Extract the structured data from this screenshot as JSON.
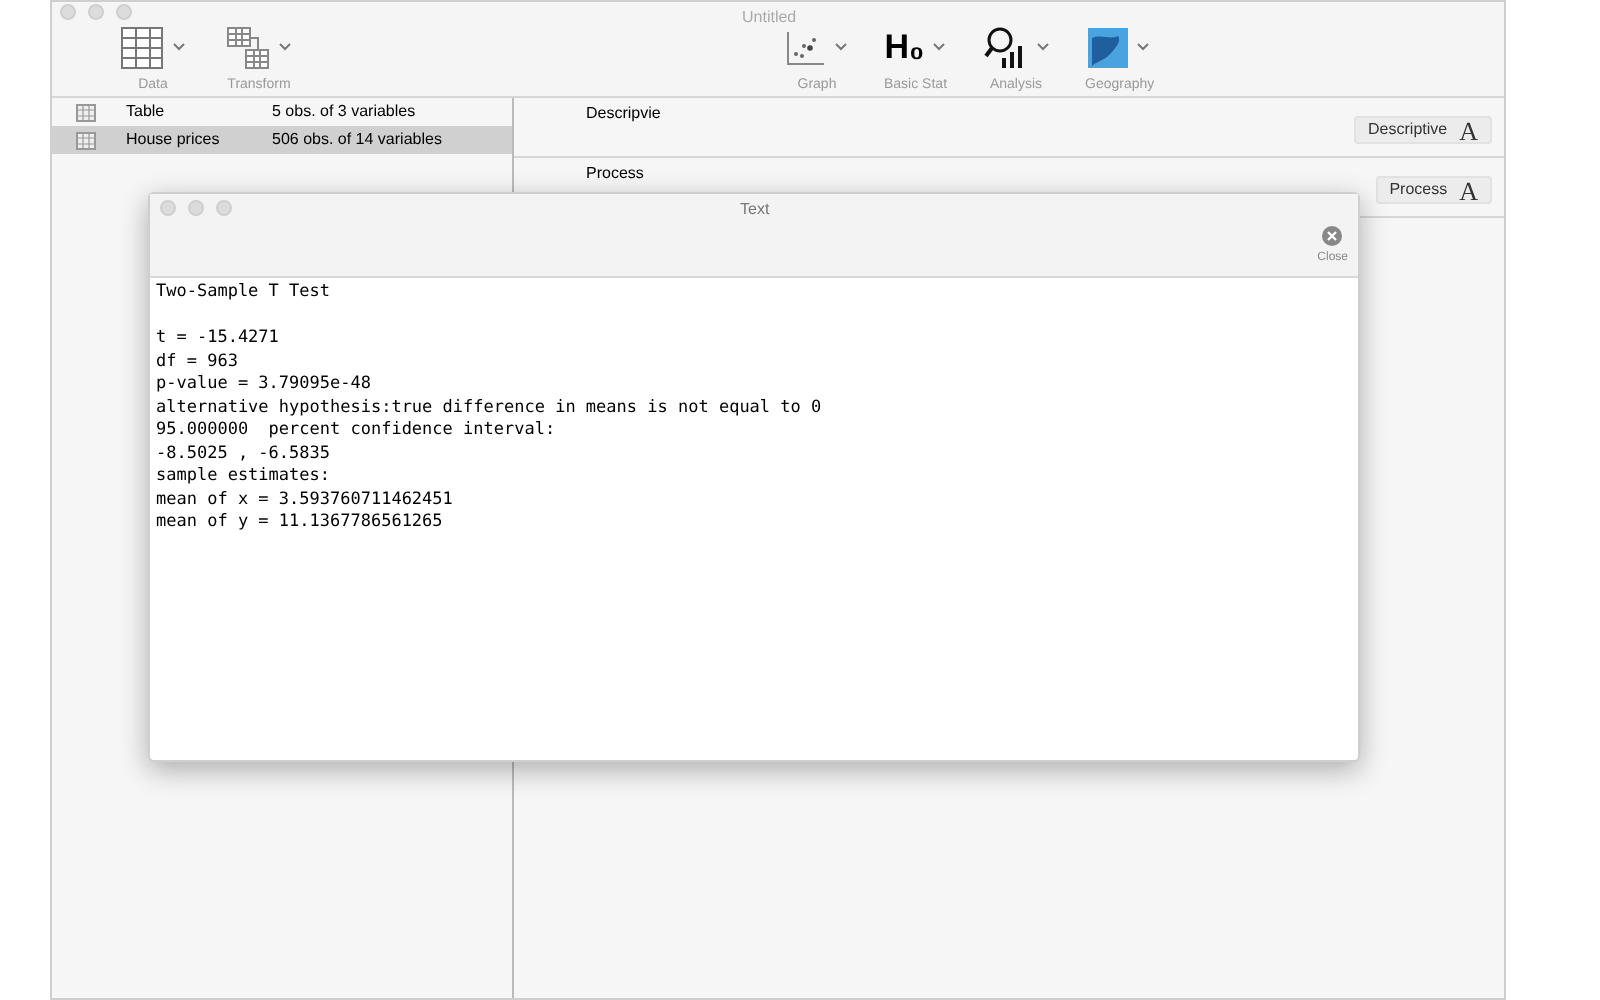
{
  "window": {
    "title": "Untitled"
  },
  "toolbar_left": [
    {
      "label": "Data",
      "kind": "table"
    },
    {
      "label": "Transform",
      "kind": "transform"
    }
  ],
  "toolbar_center": [
    {
      "label": "Graph",
      "kind": "scatter"
    },
    {
      "label": "Basic Stat",
      "kind": "hypothesis",
      "glyph": "H₀"
    },
    {
      "label": "Analysis",
      "kind": "analysis"
    },
    {
      "label": "Geography",
      "kind": "map"
    }
  ],
  "datasets": [
    {
      "name": "Table",
      "info": "5 obs. of 3 variables",
      "selected": false
    },
    {
      "name": "House prices",
      "info": "506 obs. of 14 variables",
      "selected": true
    }
  ],
  "sections": [
    {
      "title": "Descripvie",
      "button": "Descriptive",
      "glyph": "A"
    },
    {
      "title": "Process",
      "button": "Process",
      "glyph": "A"
    }
  ],
  "text_window": {
    "title": "Text",
    "close_label": "Close",
    "heading": "Two-Sample T Test",
    "lines": [
      "t = -15.4271",
      "df = 963",
      "p-value = 3.79095e-48",
      "alternative hypothesis:true difference in means is not equal to 0",
      "95.000000  percent confidence interval:",
      "-8.5025 , -6.5835",
      "sample estimates:",
      "mean of x = 3.593760711462451",
      "mean of y = 11.1367786561265"
    ]
  }
}
